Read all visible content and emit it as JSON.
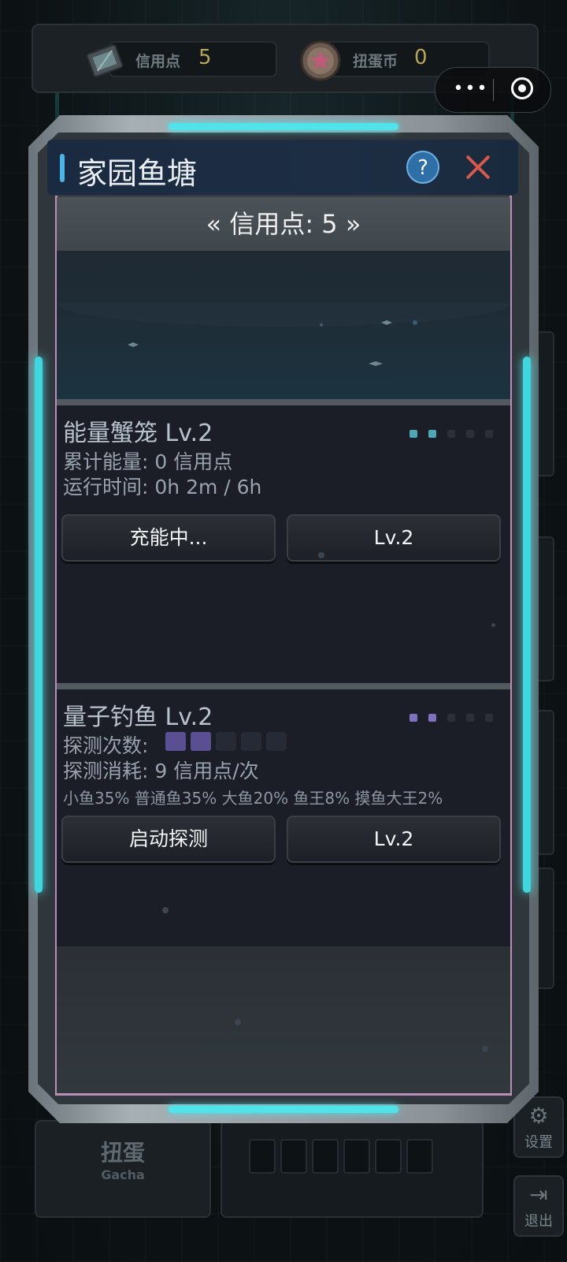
{
  "topbar": {
    "credits_label": "信用点",
    "credits_value": "5",
    "coins_label": "扭蛋币",
    "coins_value": "0"
  },
  "capsule": {
    "more_glyph": "•••"
  },
  "background": {
    "gacha_title": "扭蛋",
    "gacha_subtitle": "Gacha",
    "settings_label": "设置",
    "exit_label": "退出"
  },
  "modal": {
    "title": "家园鱼塘",
    "help_glyph": "?",
    "credits_display": "« 信用点: 5 »",
    "crab_cage": {
      "title": "能量蟹笼 Lv.2",
      "energy_line": "累计能量: 0 信用点",
      "runtime_line": "运行时间: 0h 2m / 6h",
      "level_pips": {
        "filled": 2,
        "total": 5
      },
      "action_label": "充能中...",
      "upgrade_label": "Lv.2"
    },
    "quantum_fishing": {
      "title": "量子钓鱼 Lv.2",
      "probe_label": "探测次数:",
      "probe_blocks": {
        "filled": 2,
        "total": 5
      },
      "cost_line": "探测消耗: 9 信用点/次",
      "odds_line": "小鱼35% 普通鱼35% 大鱼20% 鱼王8% 摸鱼大王2%",
      "level_pips": {
        "filled": 2,
        "total": 5
      },
      "action_label": "启动探测",
      "upgrade_label": "Lv.2"
    }
  },
  "colors": {
    "accent_teal": "#3fd6dd",
    "frame_pink": "#b98fb8",
    "close_red": "#d8584a",
    "help_blue": "#2f6fa8",
    "pip_teal": "#4fa7b6",
    "pip_purple": "#8070c0",
    "resource_gold": "#b8a45a"
  },
  "icons": {
    "credits": "chip-card-icon",
    "coins": "star-coin-icon",
    "help": "question-icon",
    "close": "close-icon",
    "settings": "gear-icon",
    "exit": "exit-door-icon"
  }
}
